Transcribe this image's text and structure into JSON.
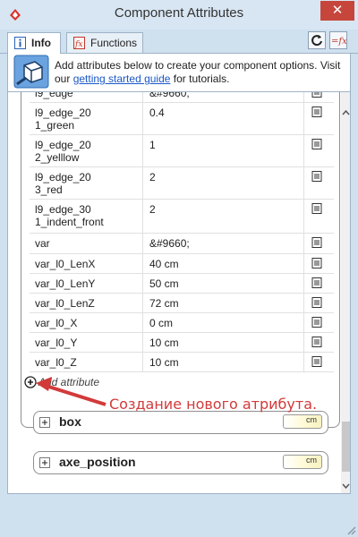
{
  "window": {
    "title": "Component Attributes",
    "close_glyph": "✕"
  },
  "tabs": [
    {
      "label": "Info",
      "icon": "info-icon",
      "active": true
    },
    {
      "label": "Functions",
      "icon": "function-icon",
      "active": false
    }
  ],
  "toolbar": {
    "refresh_icon": "refresh-icon",
    "formula_icon": "toggle-formula-icon"
  },
  "banner": {
    "text_before": "Add attributes below to create your component options. Visit our ",
    "link_text": "getting started guide",
    "text_after": " for tutorials."
  },
  "attributes": [
    {
      "name": "l9_edge",
      "value": "&#9660;"
    },
    {
      "name": "l9_edge_20\n1_green",
      "value": "0.4"
    },
    {
      "name": "l9_edge_20\n2_yelllow",
      "value": "1"
    },
    {
      "name": "l9_edge_20\n3_red",
      "value": "2"
    },
    {
      "name": "l9_edge_30\n1_indent_front",
      "value": "2"
    },
    {
      "name": "var",
      "value": "&#9660;"
    },
    {
      "name": "var_l0_LenX",
      "value": "40 cm"
    },
    {
      "name": "var_l0_LenY",
      "value": "50 cm"
    },
    {
      "name": "var_l0_LenZ",
      "value": "72 cm"
    },
    {
      "name": "var_l0_X",
      "value": "0 cm"
    },
    {
      "name": "var_l0_Y",
      "value": "10 cm"
    },
    {
      "name": "var_l0_Z",
      "value": "10 cm"
    }
  ],
  "add_attribute": {
    "label": "Add attribute"
  },
  "sections": [
    {
      "title": "box",
      "unit": "cm"
    },
    {
      "title": "axe_position",
      "unit": "cm"
    }
  ],
  "annotation": {
    "text": "Создание нового атрибута.",
    "color": "#d23a3a"
  },
  "colors": {
    "chrome": "#cfe0ef",
    "close": "#c7463c",
    "link": "#1a57c7"
  }
}
